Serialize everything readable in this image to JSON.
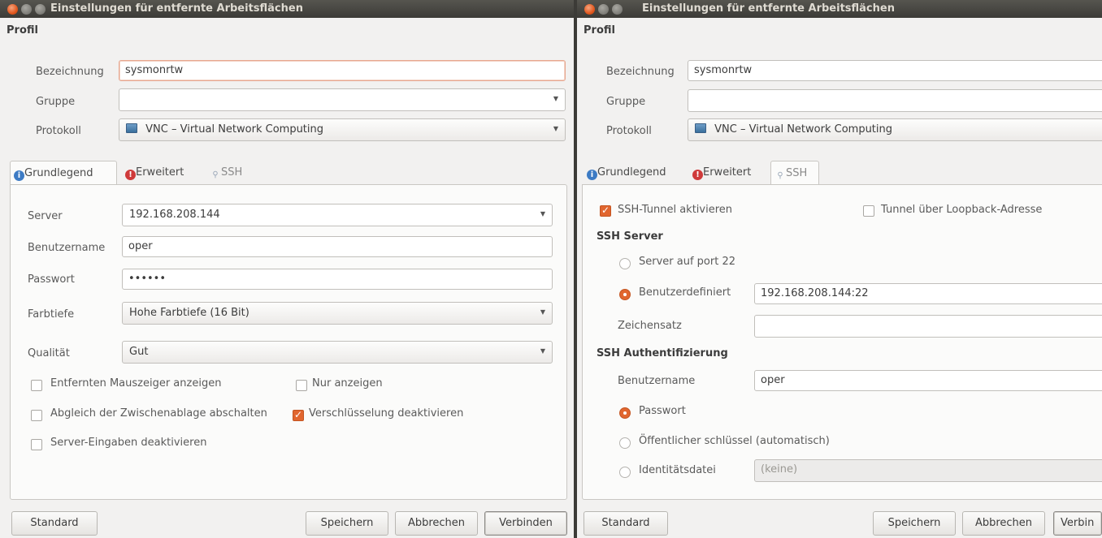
{
  "left": {
    "title": "Einstellungen für entfernte Arbeitsflächen",
    "profile": {
      "section": "Profil",
      "name_label": "Bezeichnung",
      "name_value": "sysmonrtw",
      "group_label": "Gruppe",
      "group_value": "",
      "protocol_label": "Protokoll",
      "protocol_value": "VNC – Virtual Network Computing"
    },
    "tabs": [
      {
        "label": "Grundlegend",
        "icon": "info-icon"
      },
      {
        "label": "Erweitert",
        "icon": "error-icon"
      },
      {
        "label": "SSH",
        "icon": "key-icon"
      }
    ],
    "basic": {
      "server_label": "Server",
      "server_value": "192.168.208.144",
      "user_label": "Benutzername",
      "user_value": "oper",
      "password_label": "Passwort",
      "password_value": "••••••",
      "depth_label": "Farbtiefe",
      "depth_value": "Hohe Farbtiefe (16 Bit)",
      "quality_label": "Qualität",
      "quality_value": "Gut",
      "checks": [
        {
          "label": "Entfernten Mauszeiger anzeigen",
          "checked": false
        },
        {
          "label": "Nur anzeigen",
          "checked": false
        },
        {
          "label": "Abgleich der Zwischenablage abschalten",
          "checked": false
        },
        {
          "label": "Verschlüsselung deaktivieren",
          "checked": true
        },
        {
          "label": "Server-Eingaben deaktivieren",
          "checked": false
        }
      ]
    },
    "buttons": {
      "standard": "Standard",
      "save": "Speichern",
      "cancel": "Abbrechen",
      "connect": "Verbinden"
    }
  },
  "right": {
    "title": "Einstellungen für entfernte Arbeitsflächen",
    "profile": {
      "section": "Profil",
      "name_label": "Bezeichnung",
      "name_value": "sysmonrtw",
      "group_label": "Gruppe",
      "group_value": "",
      "protocol_label": "Protokoll",
      "protocol_value": "VNC – Virtual Network Computing"
    },
    "tabs": [
      {
        "label": "Grundlegend",
        "icon": "info-icon"
      },
      {
        "label": "Erweitert",
        "icon": "error-icon"
      },
      {
        "label": "SSH",
        "icon": "key-icon"
      }
    ],
    "ssh": {
      "tunnel_label": "SSH-Tunnel aktivieren",
      "tunnel_checked": true,
      "loopback_label": "Tunnel über Loopback-Adresse",
      "loopback_checked": false,
      "server_section": "SSH Server",
      "port22_label": "Server auf port 22",
      "custom_label": "Benutzerdefiniert",
      "custom_value": "192.168.208.144:22",
      "charset_label": "Zeichensatz",
      "charset_value": "",
      "auth_section": "SSH Authentifizierung",
      "user_label": "Benutzername",
      "user_value": "oper",
      "password_label": "Passwort",
      "pubkey_label": "Öffentlicher schlüssel (automatisch)",
      "identity_label": "Identitätsdatei",
      "identity_value": "(keine)"
    },
    "buttons": {
      "standard": "Standard",
      "save": "Speichern",
      "cancel": "Abbrechen",
      "connect": "Verbin"
    }
  },
  "colors": {
    "accent": "#e1662f",
    "titlebar": "#3c3b37",
    "window_bg": "#f2f1f0"
  }
}
